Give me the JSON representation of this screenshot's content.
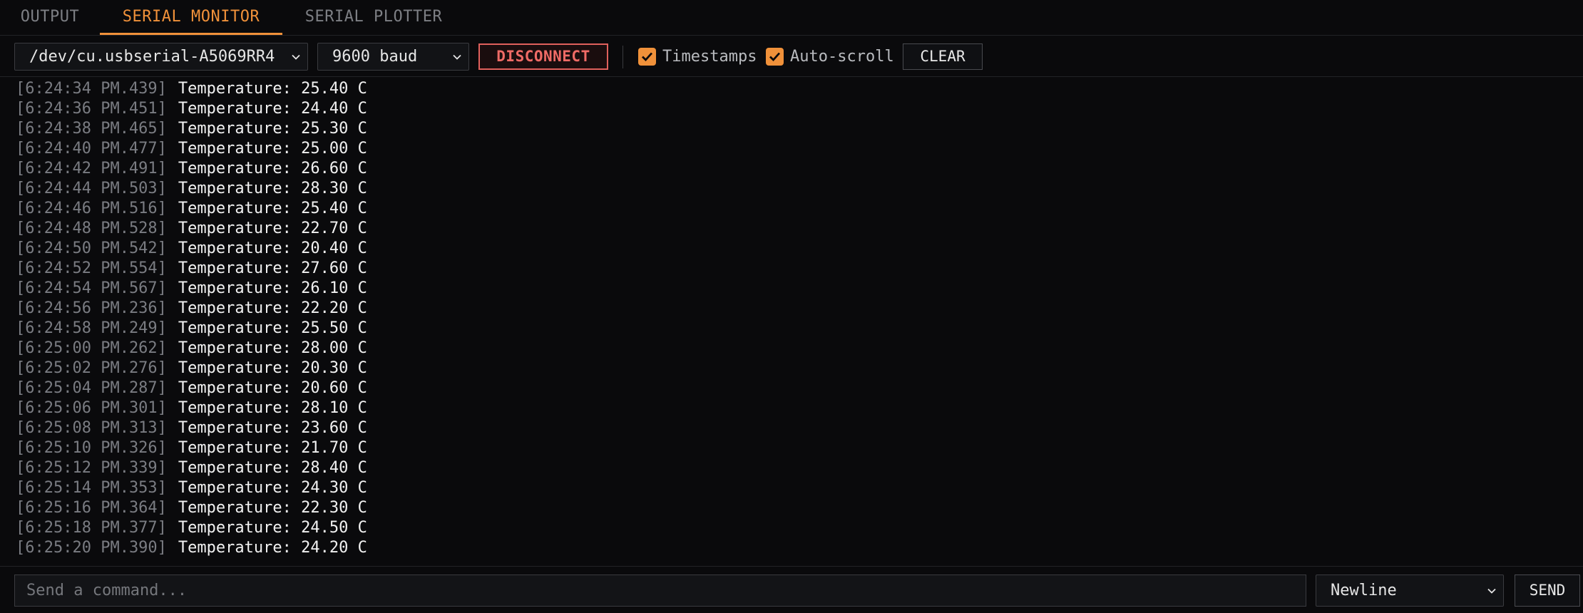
{
  "tabs": {
    "output": "OUTPUT",
    "serial_monitor": "SERIAL MONITOR",
    "serial_plotter": "SERIAL PLOTTER",
    "active": "SERIAL MONITOR"
  },
  "toolbar": {
    "port": "/dev/cu.usbserial-A5069RR4",
    "baud": "9600 baud",
    "disconnect_label": "DISCONNECT",
    "timestamps_label": "Timestamps",
    "timestamps_checked": true,
    "autoscroll_label": "Auto-scroll",
    "autoscroll_checked": true,
    "clear_label": "CLEAR"
  },
  "log": [
    {
      "ts": "[6:24:34 PM.439]",
      "msg": "Temperature: 25.40 C"
    },
    {
      "ts": "[6:24:36 PM.451]",
      "msg": "Temperature: 24.40 C"
    },
    {
      "ts": "[6:24:38 PM.465]",
      "msg": "Temperature: 25.30 C"
    },
    {
      "ts": "[6:24:40 PM.477]",
      "msg": "Temperature: 25.00 C"
    },
    {
      "ts": "[6:24:42 PM.491]",
      "msg": "Temperature: 26.60 C"
    },
    {
      "ts": "[6:24:44 PM.503]",
      "msg": "Temperature: 28.30 C"
    },
    {
      "ts": "[6:24:46 PM.516]",
      "msg": "Temperature: 25.40 C"
    },
    {
      "ts": "[6:24:48 PM.528]",
      "msg": "Temperature: 22.70 C"
    },
    {
      "ts": "[6:24:50 PM.542]",
      "msg": "Temperature: 20.40 C"
    },
    {
      "ts": "[6:24:52 PM.554]",
      "msg": "Temperature: 27.60 C"
    },
    {
      "ts": "[6:24:54 PM.567]",
      "msg": "Temperature: 26.10 C"
    },
    {
      "ts": "[6:24:56 PM.236]",
      "msg": "Temperature: 22.20 C"
    },
    {
      "ts": "[6:24:58 PM.249]",
      "msg": "Temperature: 25.50 C"
    },
    {
      "ts": "[6:25:00 PM.262]",
      "msg": "Temperature: 28.00 C"
    },
    {
      "ts": "[6:25:02 PM.276]",
      "msg": "Temperature: 20.30 C"
    },
    {
      "ts": "[6:25:04 PM.287]",
      "msg": "Temperature: 20.60 C"
    },
    {
      "ts": "[6:25:06 PM.301]",
      "msg": "Temperature: 28.10 C"
    },
    {
      "ts": "[6:25:08 PM.313]",
      "msg": "Temperature: 23.60 C"
    },
    {
      "ts": "[6:25:10 PM.326]",
      "msg": "Temperature: 21.70 C"
    },
    {
      "ts": "[6:25:12 PM.339]",
      "msg": "Temperature: 28.40 C"
    },
    {
      "ts": "[6:25:14 PM.353]",
      "msg": "Temperature: 24.30 C"
    },
    {
      "ts": "[6:25:16 PM.364]",
      "msg": "Temperature: 22.30 C"
    },
    {
      "ts": "[6:25:18 PM.377]",
      "msg": "Temperature: 24.50 C"
    },
    {
      "ts": "[6:25:20 PM.390]",
      "msg": "Temperature: 24.20 C"
    }
  ],
  "input": {
    "placeholder": "Send a command...",
    "value": "",
    "line_ending": "Newline",
    "send_label": "SEND"
  },
  "colors": {
    "accent": "#f0913a",
    "danger": "#ef6b66",
    "background": "#0a0a0c"
  },
  "icons": {
    "select_chevron": "chevron-down-icon",
    "checkbox_check": "checkmark-icon"
  }
}
